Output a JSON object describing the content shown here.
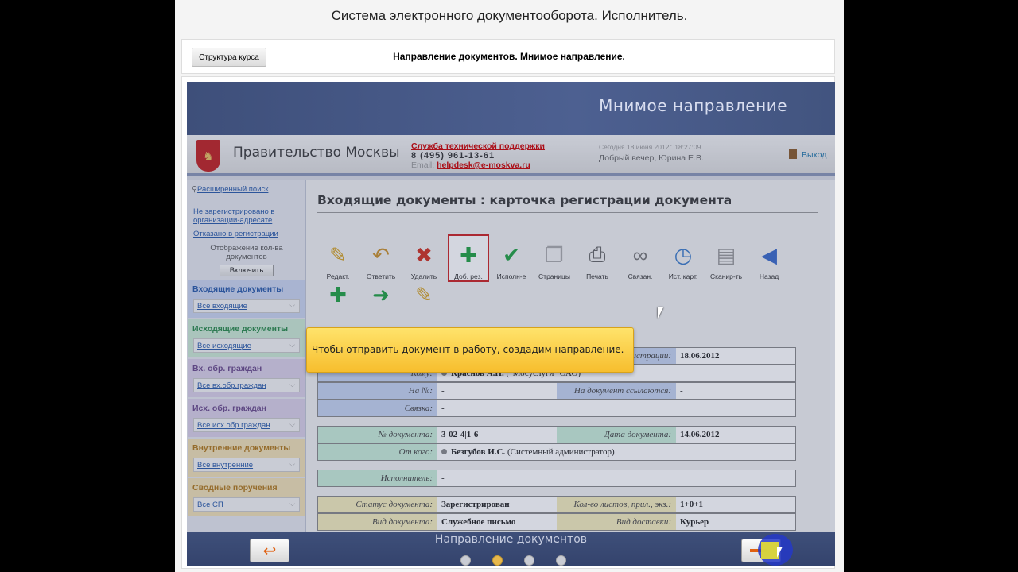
{
  "course_title": "Система электронного документооборота. Исполнитель.",
  "nav": {
    "structure_button": "Структура курса",
    "caption": "Направление документов. Мнимое направление."
  },
  "banner_title": "Мнимое направление",
  "app": {
    "gov_name": "Правительство Москвы",
    "support_title": "Служба технической поддержки",
    "support_phone": "8 (495) 961-13-61",
    "email_label": "Email:",
    "email": "helpdesk@e-moskva.ru",
    "date_text": "Сегодня 18 июня 2012г. 18:27:09",
    "greeting": "Добрый вечер, Юрина Е.В.",
    "exit": "Выход"
  },
  "sidebar": {
    "adv_search": "Расширенный поиск",
    "link1": "Не зарегистрировано в организации-адресате",
    "link2": "Отказано в регистрации",
    "count_label": "Отображение кол-ва документов",
    "enable": "Включить",
    "sections": [
      {
        "title": "Входящие документы",
        "select": "Все входящие",
        "color": "#2a5aa8",
        "bg": "#c9d4ee"
      },
      {
        "title": "Исходящие документы",
        "select": "Все исходящие",
        "color": "#2a8a4a",
        "bg": "#cbe8d3"
      },
      {
        "title": "Вх. обр. граждан",
        "select": "Все вх.обр.граждан",
        "color": "#6a4a8a",
        "bg": "#d9cfe6"
      },
      {
        "title": "Исх. обр. граждан",
        "select": "Все исх.обр.граждан",
        "color": "#6a4a8a",
        "bg": "#d9cfe6"
      },
      {
        "title": "Внутренние документы",
        "select": "Все внутренние",
        "color": "#b0781a",
        "bg": "#f0dfb4"
      },
      {
        "title": "Сводные поручения",
        "select": "Все СП",
        "color": "#b0781a",
        "bg": "#f0dfb4"
      }
    ]
  },
  "content": {
    "title": "Входящие документы : карточка регистрации документа",
    "toolbar": [
      {
        "label": "Редакт.",
        "icon": "edit-icon",
        "glyph": "✎",
        "color": "#d4a020"
      },
      {
        "label": "Ответить",
        "icon": "reply-icon",
        "glyph": "↶",
        "color": "#c9902a"
      },
      {
        "label": "Удалить",
        "icon": "delete-icon",
        "glyph": "✖",
        "color": "#d03020"
      },
      {
        "label": "Доб. рез.",
        "icon": "add-resolution-icon",
        "glyph": "✚",
        "color": "#20a040"
      },
      {
        "label": "Исполн-е",
        "icon": "execution-icon",
        "glyph": "✔",
        "color": "#20a040"
      },
      {
        "label": "Страницы",
        "icon": "pages-icon",
        "glyph": "❐",
        "color": "#aaaaaa"
      },
      {
        "label": "Печать",
        "icon": "print-icon",
        "glyph": "⎙",
        "color": "#666666"
      },
      {
        "label": "Связан.",
        "icon": "link-icon",
        "glyph": "∞",
        "color": "#777777"
      },
      {
        "label": "Ист. карт.",
        "icon": "history-icon",
        "glyph": "◷",
        "color": "#3a7ac8"
      },
      {
        "label": "Сканир-ть",
        "icon": "scan-icon",
        "glyph": "▤",
        "color": "#999999"
      },
      {
        "label": "Назад",
        "icon": "back-icon",
        "glyph": "◀",
        "color": "#3a6ac8"
      }
    ],
    "toolbar_row2": [
      {
        "icon": "add-doc-icon",
        "glyph": "✚",
        "color": "#20a040"
      },
      {
        "icon": "forward-icon",
        "glyph": "➜",
        "color": "#20a040"
      },
      {
        "icon": "sign-icon",
        "glyph": "✎",
        "color": "#d4a020"
      }
    ]
  },
  "tooltip": "Чтобы отправить документ в работу, создадим направление.",
  "form": {
    "reg_date_label": "Дата регистрации:",
    "reg_date": "18.06.2012",
    "to_label": "Кому:",
    "to_name": "Краснов А.Н.",
    "to_org": " (\"Мосуслуги\" ОАО)",
    "num_label": "На №:",
    "num_value": "-",
    "ref_label": "На документ ссылаются:",
    "ref_value": "-",
    "link_label": "Связка:",
    "link_value": "-",
    "docnum_label": "№ документа:",
    "docnum": "3-02-4|1-6",
    "docdate_label": "Дата документа:",
    "docdate": "14.06.2012",
    "from_label": "От кого:",
    "from_name": "Безгубов И.С.",
    "from_role": " (Системный администратор)",
    "executor_label": "Исполнитель:",
    "executor": "-",
    "status_label": "Статус документа:",
    "status": "Зарегистрирован",
    "sheets_label": "Кол-во листов, прил., экз.:",
    "sheets": "1+0+1",
    "kind_label": "Вид документа:",
    "kind": "Служебное письмо",
    "delivery_label": "Вид доставки:",
    "delivery": "Курьер"
  },
  "footer": {
    "title": "Направление документов",
    "active_page": 2,
    "pages": 4
  }
}
